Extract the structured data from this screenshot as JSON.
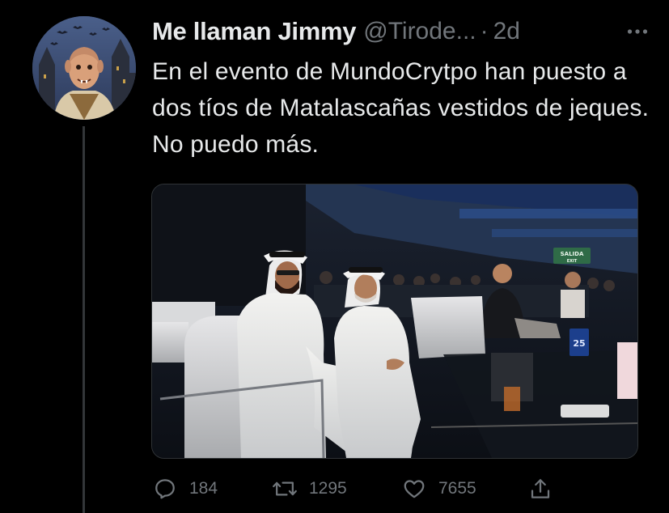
{
  "tweet": {
    "display_name": "Me llaman Jimmy",
    "handle": "@Tirode...",
    "separator": "·",
    "time": "2d",
    "more_icon": "more-horizontal-icon",
    "text": "En el evento de MundoCrytpo han puesto a dos tíos de Matalascañas vestidos de jeques. No puedo más.",
    "media": {
      "sign_text": "SALIDA",
      "sign_subtext": "EXIT",
      "table_number": "25"
    }
  },
  "actions": {
    "reply": {
      "icon": "reply-icon",
      "count": "184"
    },
    "retweet": {
      "icon": "retweet-icon",
      "count": "1295"
    },
    "like": {
      "icon": "like-icon",
      "count": "7655"
    },
    "share": {
      "icon": "share-icon"
    }
  },
  "colors": {
    "background": "#000000",
    "primary_text": "#e7e9ea",
    "secondary_text": "#71767b",
    "thread_line": "#333639",
    "sign_green": "#2f6b47"
  }
}
